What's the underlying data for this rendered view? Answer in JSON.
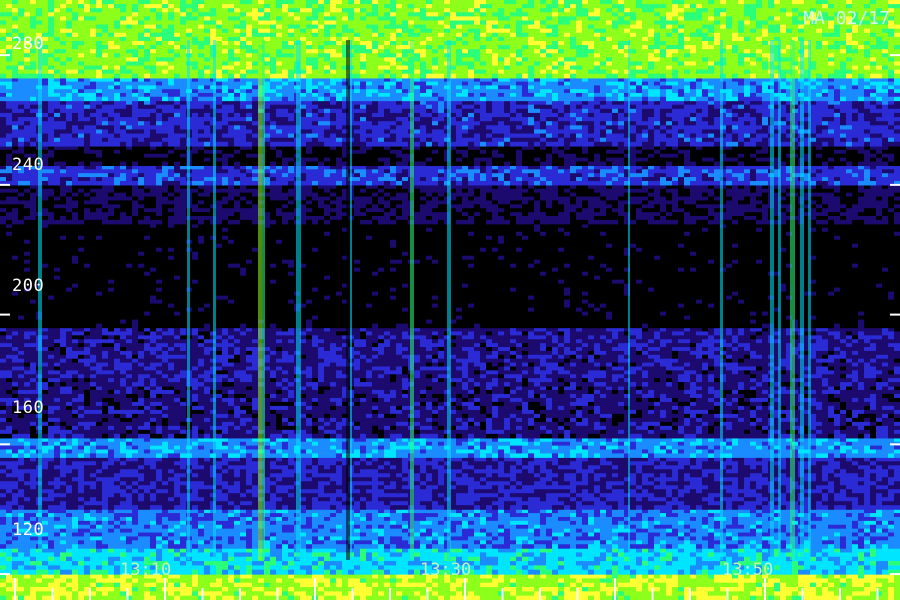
{
  "header": {
    "corner_label": "MA 02/17"
  },
  "chart_data": {
    "type": "heatmap",
    "title": "",
    "xlabel": "",
    "ylabel": "",
    "x_tick_labels": [
      "13:10",
      "13:30",
      "13:50"
    ],
    "y_ticks": [
      120,
      160,
      200,
      240,
      280
    ],
    "ylim": [
      112,
      297
    ],
    "colormap": [
      "#000000",
      "#1c0a6e",
      "#2b2bd6",
      "#1a8cff",
      "#00e5ff",
      "#2bff7a",
      "#8cff1a",
      "#ffff33"
    ],
    "intensity_bands": [
      {
        "from": 112,
        "to": 120,
        "level": 0.85
      },
      {
        "from": 120,
        "to": 128,
        "level": 0.55
      },
      {
        "from": 128,
        "to": 140,
        "level": 0.42
      },
      {
        "from": 140,
        "to": 156,
        "level": 0.25
      },
      {
        "from": 156,
        "to": 162,
        "level": 0.45
      },
      {
        "from": 162,
        "to": 178,
        "level": 0.2
      },
      {
        "from": 178,
        "to": 196,
        "level": 0.22
      },
      {
        "from": 196,
        "to": 228,
        "level": 0.03
      },
      {
        "from": 228,
        "to": 240,
        "level": 0.14
      },
      {
        "from": 240,
        "to": 246,
        "level": 0.32
      },
      {
        "from": 246,
        "to": 252,
        "level": 0.1
      },
      {
        "from": 252,
        "to": 266,
        "level": 0.28
      },
      {
        "from": 266,
        "to": 273,
        "level": 0.45
      },
      {
        "from": 273,
        "to": 297,
        "level": 0.8
      }
    ]
  }
}
